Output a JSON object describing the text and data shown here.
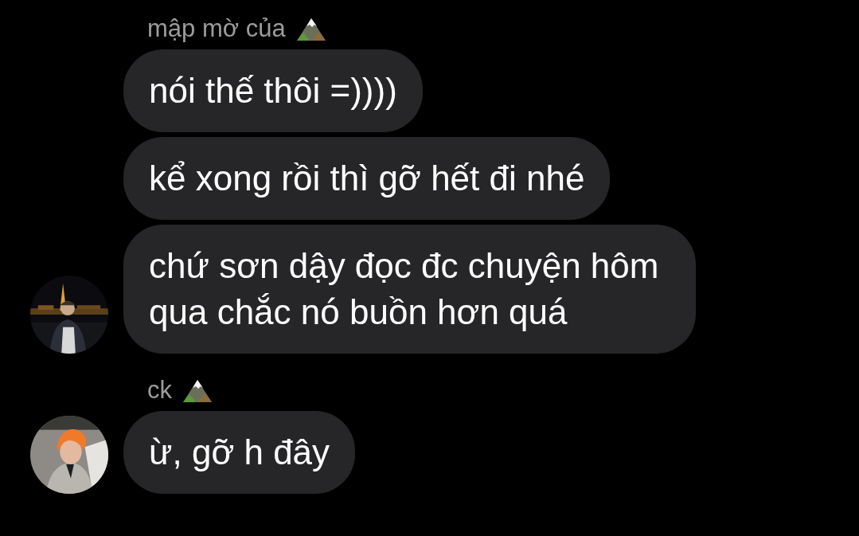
{
  "groups": [
    {
      "sender": "mập mờ của",
      "messages": [
        "nói thế thôi =))))",
        "kể xong rồi thì gỡ hết đi nhé",
        "chứ sơn dậy đọc đc chuyện hôm qua chắc nó buồn hơn quá"
      ]
    },
    {
      "sender": "ck",
      "messages": [
        "ừ, gỡ h đây"
      ]
    }
  ]
}
